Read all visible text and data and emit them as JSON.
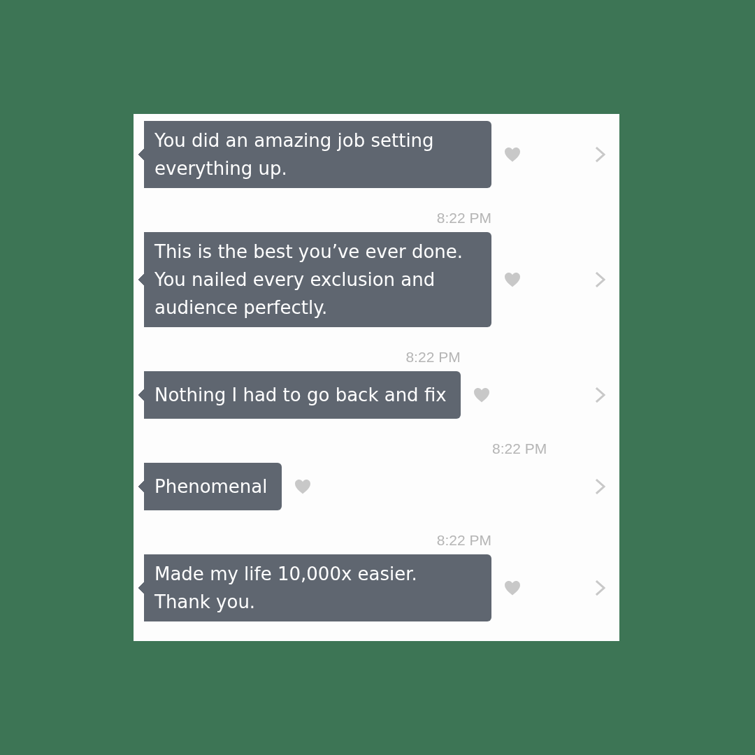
{
  "messages": [
    {
      "text": "You did an amazing job setting everything up."
    },
    {
      "timestamp": "8:22 PM",
      "text": "This is the best you’ve ever done. You nailed every exclusion and audience perfectly."
    },
    {
      "timestamp": "8:22 PM",
      "text": "Nothing I had to go back and fix"
    },
    {
      "timestamp": "8:22 PM",
      "text": "Phenomenal"
    },
    {
      "timestamp": "8:22 PM",
      "text": "Made my life 10,000x easier. Thank you."
    }
  ]
}
